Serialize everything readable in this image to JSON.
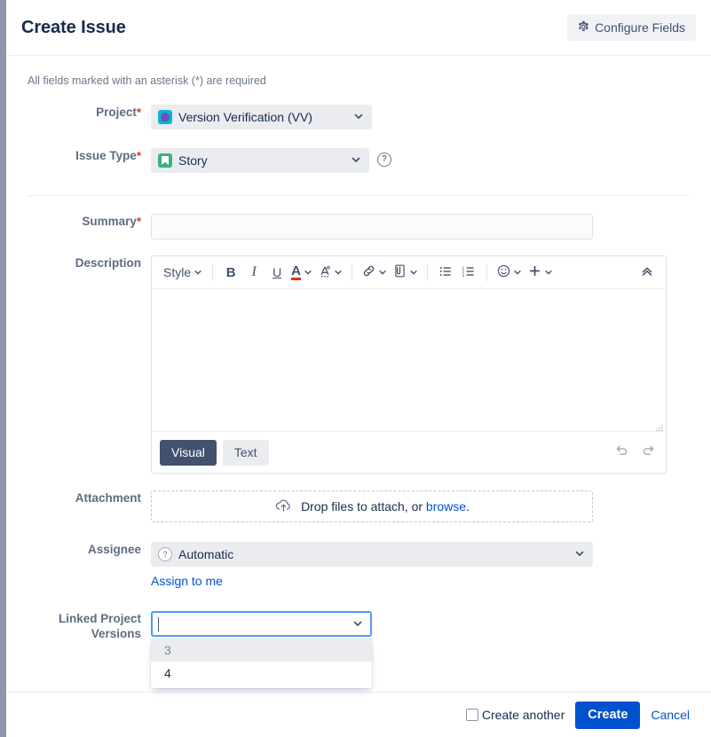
{
  "header": {
    "title": "Create Issue",
    "configure_fields_label": "Configure Fields"
  },
  "body": {
    "required_note": "All fields marked with an asterisk (*) are required"
  },
  "fields": {
    "project": {
      "label": "Project",
      "required_mark": "*",
      "value": "Version Verification (VV)"
    },
    "issue_type": {
      "label": "Issue Type",
      "required_mark": "*",
      "value": "Story",
      "help_glyph": "?"
    },
    "summary": {
      "label": "Summary",
      "required_mark": "*",
      "value": "",
      "placeholder": ""
    },
    "description": {
      "label": "Description",
      "value": "",
      "toolbar": {
        "style_label": "Style",
        "bold_label": "B",
        "italic_label": "I",
        "underline_label": "U",
        "text_color_label": "A",
        "highlight_label": "A"
      },
      "modes": [
        {
          "label": "Visual",
          "active": true
        },
        {
          "label": "Text",
          "active": false
        }
      ]
    },
    "attachment": {
      "label": "Attachment",
      "drop_text": "Drop files to attach, or ",
      "browse_link": "browse",
      "drop_text_end": "."
    },
    "assignee": {
      "label": "Assignee",
      "value": "Automatic",
      "avatar_glyph": "?",
      "assign_to_me_label": "Assign to me"
    },
    "linked_project_versions": {
      "label_line1": "Linked Project",
      "label_line2": "Versions",
      "value": "",
      "options": [
        {
          "label": "3",
          "highlighted": true
        },
        {
          "label": "4",
          "highlighted": false
        }
      ]
    }
  },
  "footer": {
    "create_another_label": "Create another",
    "create_another_checked": false,
    "create_label": "Create",
    "cancel_label": "Cancel"
  },
  "colors": {
    "accent_blue": "#0052cc",
    "focus_blue": "#4c9aff",
    "required_red": "#de350b",
    "dark_navy": "#172b4d",
    "label_gray": "#5e6c84",
    "story_green": "#36b37e",
    "project_cyan": "#0ab4d4"
  }
}
